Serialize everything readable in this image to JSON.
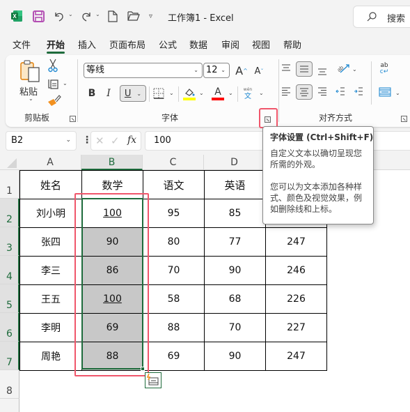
{
  "titlebar": {
    "title": "工作簿1  -  Excel",
    "search_label": "搜索",
    "icons": [
      "excel-logo-icon",
      "save-icon",
      "undo-icon",
      "redo-icon",
      "new-file-icon",
      "open-folder-icon",
      "customize-quick-access-icon",
      "search-icon"
    ]
  },
  "tabs": [
    {
      "label": "文件"
    },
    {
      "label": "开始",
      "active": true
    },
    {
      "label": "插入"
    },
    {
      "label": "页面布局"
    },
    {
      "label": "公式"
    },
    {
      "label": "数据"
    },
    {
      "label": "审阅"
    },
    {
      "label": "视图"
    },
    {
      "label": "帮助"
    }
  ],
  "ribbon": {
    "clipboard": {
      "label": "剪贴板",
      "paste_label": "粘贴"
    },
    "font": {
      "label": "字体",
      "font_name": "等线",
      "font_size": "12",
      "bold_label": "B",
      "italic_label": "I",
      "underline_label": "U",
      "grow_label": "A",
      "shrink_label": "A",
      "font_color_label": "A",
      "highlight_color": "#ffff00",
      "font_color": "#ff0000",
      "phonetic_label": "wén",
      "phonetic_char": "文"
    },
    "alignment": {
      "label": "对齐方式",
      "wrap_label": "ab"
    }
  },
  "formula_bar": {
    "name_box": "B2",
    "fx_label": "fx",
    "value": "100"
  },
  "sheet": {
    "columns": [
      "A",
      "B",
      "C",
      "D"
    ],
    "selected_column": "B",
    "rows": [
      "1",
      "2",
      "3",
      "4",
      "5",
      "6",
      "7",
      "8"
    ],
    "header": [
      "姓名",
      "数学",
      "语文",
      "英语",
      ""
    ],
    "data": [
      [
        "刘小明",
        "100",
        "95",
        "85",
        ""
      ],
      [
        "张四",
        "90",
        "80",
        "77",
        "247"
      ],
      [
        "李三",
        "86",
        "70",
        "90",
        "246"
      ],
      [
        "王五",
        "100",
        "58",
        "68",
        "226"
      ],
      [
        "李明",
        "69",
        "88",
        "70",
        "227"
      ],
      [
        "周艳",
        "88",
        "69",
        "90",
        "247"
      ]
    ]
  },
  "tooltip": {
    "title": "字体设置 (Ctrl+Shift+F)",
    "line1": "自定义文本以确切呈现您所需的外观。",
    "line2": "您可以为文本添加各种样式、颜色及视觉效果，例如删除线和上标。"
  },
  "colors": {
    "accent": "#1e6b3c",
    "highlight_box": "#f0566b",
    "selected_fill": "#c8c8c8"
  }
}
